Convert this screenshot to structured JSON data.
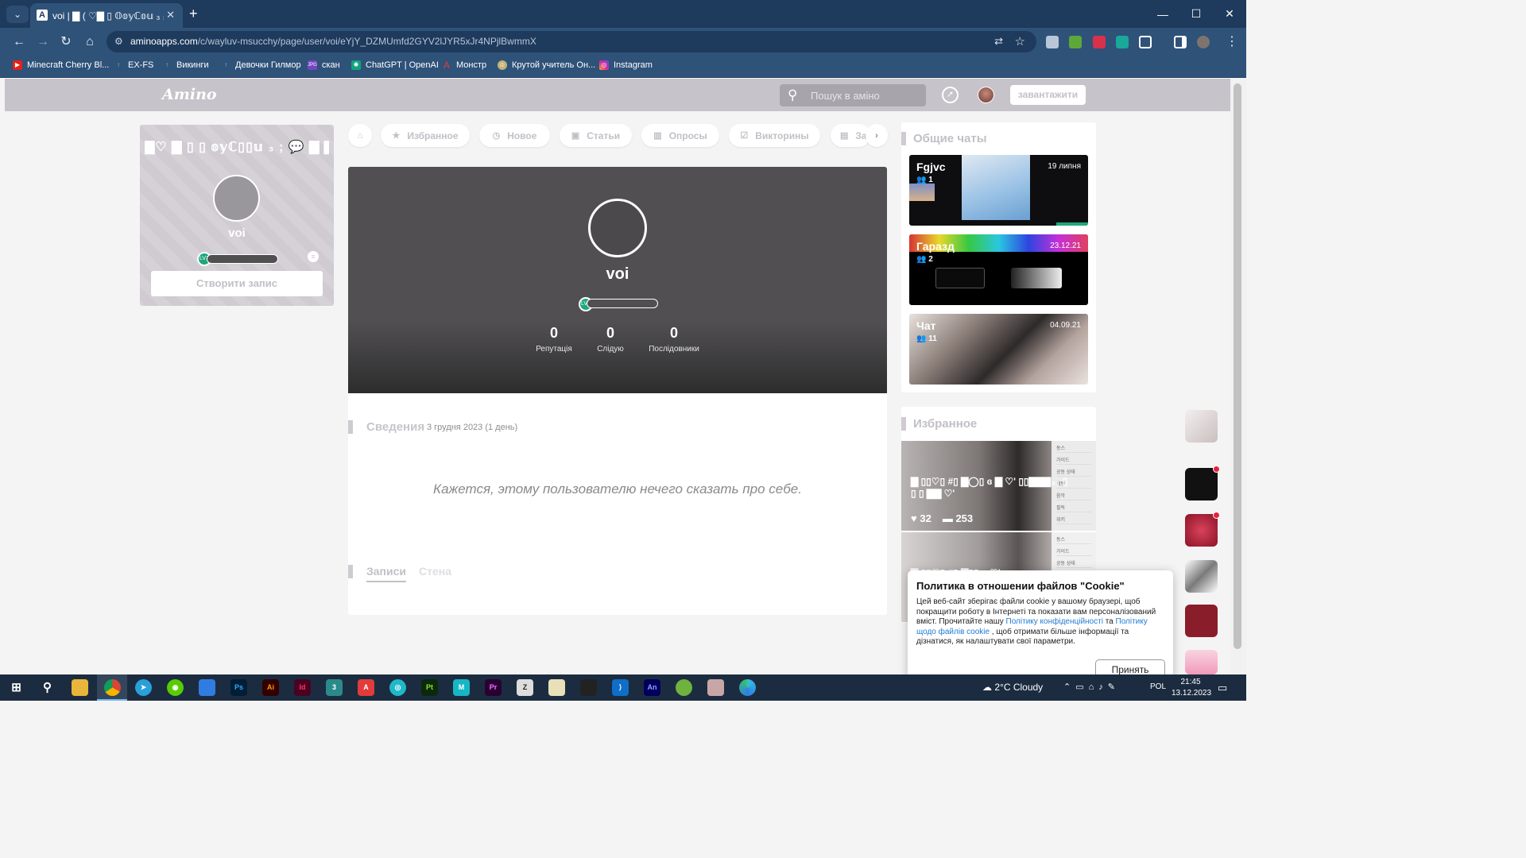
{
  "browser": {
    "tab_title": "voi | ▇ ( ♡▇ ▯ 𝕆𝕠𝕪ℂ𝕠𝕦 ₃ ₃ 💬",
    "tab_favicon": "A",
    "url_host": "aminoapps.com",
    "url_path": "/c/wayluv-msucchy/page/user/voi/eYjY_DZMUmfd2GYV2lJYR5xJr4NPjlBwmmX",
    "bookmarks": [
      "Minecraft Cherry Bl...",
      "EX-FS",
      "Викинги",
      "Девочки Гилмор",
      "скан",
      "ChatGPT | OpenAI",
      "Монстр",
      "Крутой учитель Он...",
      "Instagram"
    ]
  },
  "header": {
    "logo": "Amino",
    "search_placeholder": "Пошук в аміно",
    "download_label": "завантажити"
  },
  "left_card": {
    "nickname": "▇♡ ▇ ▯ ▯ 𝕠𝕪ℂ▯▯𝕦 ₃ ; 💬 ▇ ▇",
    "username": "voi",
    "level": "LV1",
    "create_post": "Створити запис"
  },
  "nav_pills": [
    "Избранное",
    "Новое",
    "Статьи",
    "Опросы",
    "Викторины",
    "За"
  ],
  "profile": {
    "username": "voi",
    "level": "LV1",
    "stats": [
      {
        "value": "0",
        "label": "Репутація"
      },
      {
        "value": "0",
        "label": "Слідую"
      },
      {
        "value": "0",
        "label": "Послідовники"
      }
    ],
    "about_title": "Сведения",
    "about_date": "3 грудня 2023 (1 день)",
    "empty_bio": "Кажется, этому пользователю нечего сказать про себе.",
    "tab_posts": "Записи",
    "tab_wall": "Стена"
  },
  "public_chats": {
    "title": "Общие чаты",
    "items": [
      {
        "name": "Fgjvc",
        "date": "19 липня",
        "members": "1"
      },
      {
        "name": "Гаразд",
        "date": "23.12.21",
        "members": "2"
      },
      {
        "name": "Чат",
        "date": "04.09.21",
        "members": "11"
      }
    ]
  },
  "featured": {
    "title": "Избранное",
    "items": [
      {
        "text": "▇ ▯▯♡▯ #▯ ▇◯▯ ɞ ▇ ♡' ▯▯▇▇▇₃₃ ▯ ▯ ▯ ▇▇ ♡'",
        "likes": "32",
        "comments": "253"
      },
      {
        "text": "▇ ▯▯♡▯ #▯ ▇▯▯ ɞ ♡'",
        "likes": "",
        "comments": ""
      }
    ]
  },
  "cookie_banner": {
    "title": "Политика в отношении файлов \"Cookie\"",
    "body_1": "Цей веб-сайт зберігає файли cookie у вашому браузері, щоб покращити роботу в Інтернеті та показати вам персоналізований вміст. Прочитайте нашу ",
    "link_1": "Політику конфіденційності",
    "body_2": " та ",
    "link_2": "Політику щодо файлів cookie",
    "body_3": " , щоб отримати більше інформації та дізнатися, як налаштувати свої параметри.",
    "accept": "Принять"
  },
  "taskbar": {
    "weather": "2°C  Cloudy",
    "lang": "POL",
    "time": "21:45",
    "date": "13.12.2023"
  }
}
